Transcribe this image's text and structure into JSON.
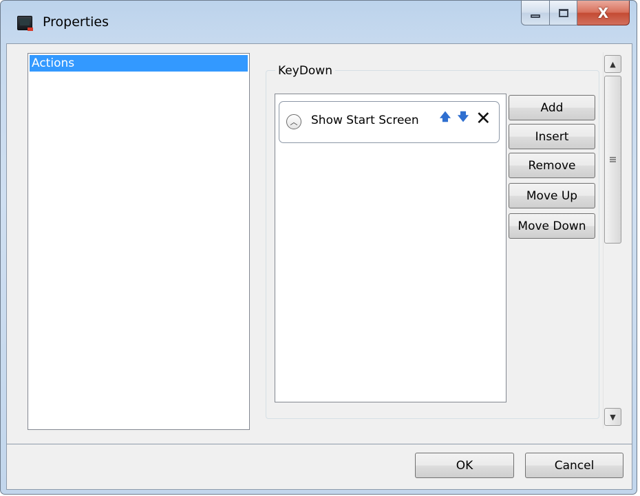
{
  "window": {
    "title": "Properties",
    "controls": {
      "minimize": "minimize",
      "maximize": "maximize",
      "close": "X"
    }
  },
  "sidebar": {
    "items": [
      {
        "label": "Actions",
        "selected": true
      }
    ]
  },
  "event_group": {
    "header": "KeyDown",
    "actions": [
      {
        "label": "Show Start Screen"
      }
    ],
    "buttons": {
      "add": "Add",
      "insert": "Insert",
      "remove": "Remove",
      "move_up": "Move Up",
      "move_down": "Move Down"
    }
  },
  "footer": {
    "ok": "OK",
    "cancel": "Cancel"
  },
  "icons": {
    "app": "console-window-icon",
    "expander": "chevron-up-circle-icon",
    "move_up": "arrow-up-icon",
    "move_down": "arrow-down-icon",
    "delete": "close-x-icon"
  },
  "colors": {
    "selection": "#3399ff",
    "titlebar": "#c6d9ee",
    "close_button": "#c44b34",
    "arrow_icon": "#2f6fd0"
  }
}
